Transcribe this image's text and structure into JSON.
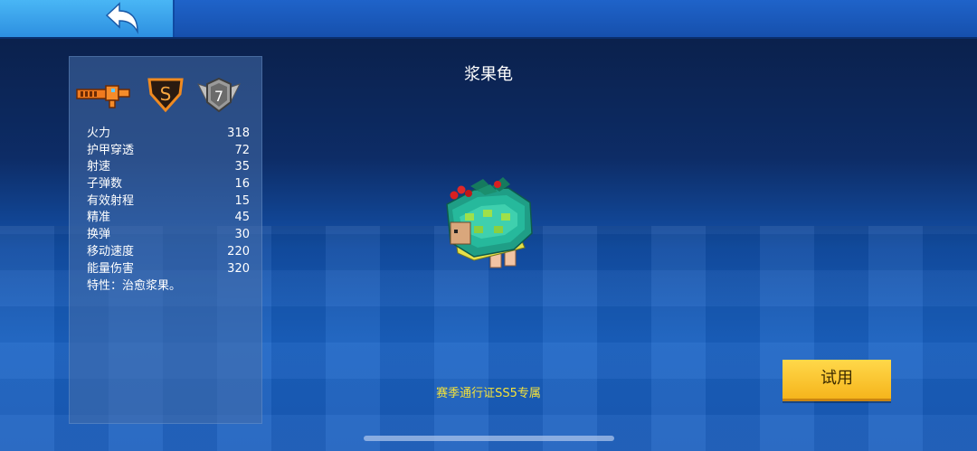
{
  "item": {
    "name": "浆果龟",
    "exclusive_note": "赛季通行证SS5专属",
    "try_label": "试用"
  },
  "badges": {
    "weapon_icon": "orange-blaster-icon",
    "rarity_letter": "S",
    "tier_number": "7"
  },
  "stats": [
    {
      "label": "火力",
      "value": "318"
    },
    {
      "label": "护甲穿透",
      "value": "72"
    },
    {
      "label": "射速",
      "value": "35"
    },
    {
      "label": "子弹数",
      "value": "16"
    },
    {
      "label": "有效射程",
      "value": "15"
    },
    {
      "label": "精准",
      "value": "45"
    },
    {
      "label": "换弹",
      "value": "30"
    },
    {
      "label": "移动速度",
      "value": "220"
    },
    {
      "label": "能量伤害",
      "value": "320"
    }
  ],
  "trait": "特性：治愈浆果。",
  "colors": {
    "accent_yellow": "#f6b51c",
    "exclusive_text": "#f5e23a",
    "topbar_blue": "#1650ad",
    "back_button": "#2d8fe0"
  }
}
